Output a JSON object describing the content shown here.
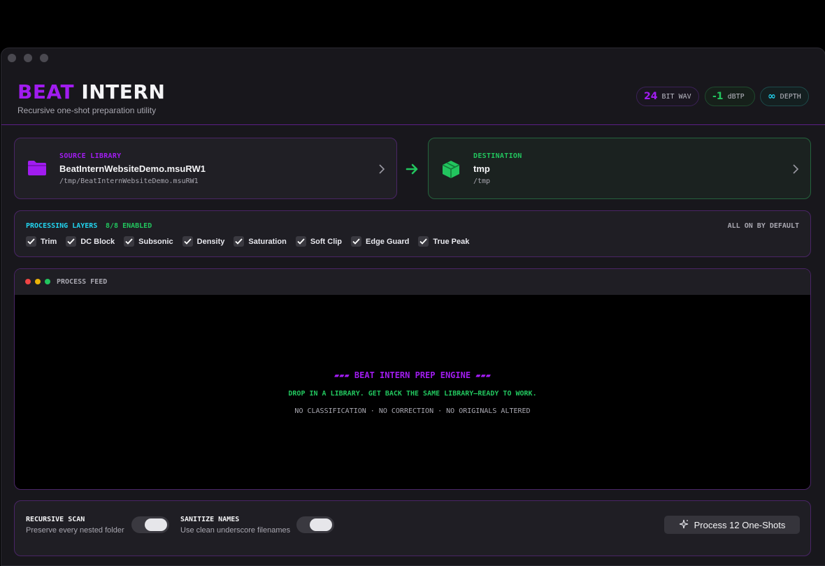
{
  "header": {
    "brand_a": "BEAT",
    "brand_b": "INTERN",
    "subtitle": "Recursive one-shot preparation utility",
    "pills": [
      {
        "num": "24",
        "label": "BIT WAV"
      },
      {
        "num": "-1",
        "label": "dBTP"
      },
      {
        "num": "∞",
        "label": "DEPTH"
      }
    ]
  },
  "source": {
    "kicker": "SOURCE LIBRARY",
    "name": "BeatInternWebsiteDemo.msuRW1",
    "path": "/tmp/BeatInternWebsiteDemo.msuRW1",
    "icon": "folder-icon"
  },
  "destination": {
    "kicker": "DESTINATION",
    "name": "tmp",
    "path": "/tmp",
    "icon": "package-icon"
  },
  "layers": {
    "label": "PROCESSING LAYERS",
    "count": "8/8 ENABLED",
    "default_note": "ALL ON BY DEFAULT",
    "items": [
      "Trim",
      "DC Block",
      "Subsonic",
      "Density",
      "Saturation",
      "Soft Clip",
      "Edge Guard",
      "True Peak"
    ]
  },
  "feed": {
    "title": "PROCESS FEED",
    "line1": "▰▰▰  BEAT INTERN PREP ENGINE  ▰▰▰",
    "line2": "DROP IN A LIBRARY. GET BACK THE SAME LIBRARY—READY TO WORK.",
    "line3": "NO CLASSIFICATION · NO CORRECTION · NO ORIGINALS ALTERED"
  },
  "options": {
    "recursive_title": "RECURSIVE SCAN",
    "recursive_desc": "Preserve every nested folder",
    "sanitize_title": "SANITIZE NAMES",
    "sanitize_desc": "Use clean underscore filenames"
  },
  "actions": {
    "process_label": "Process 12 One-Shots"
  },
  "colors": {
    "accent_purple": "#a11cf0",
    "accent_green": "#22c55e",
    "accent_cyan": "#22d3ee"
  }
}
